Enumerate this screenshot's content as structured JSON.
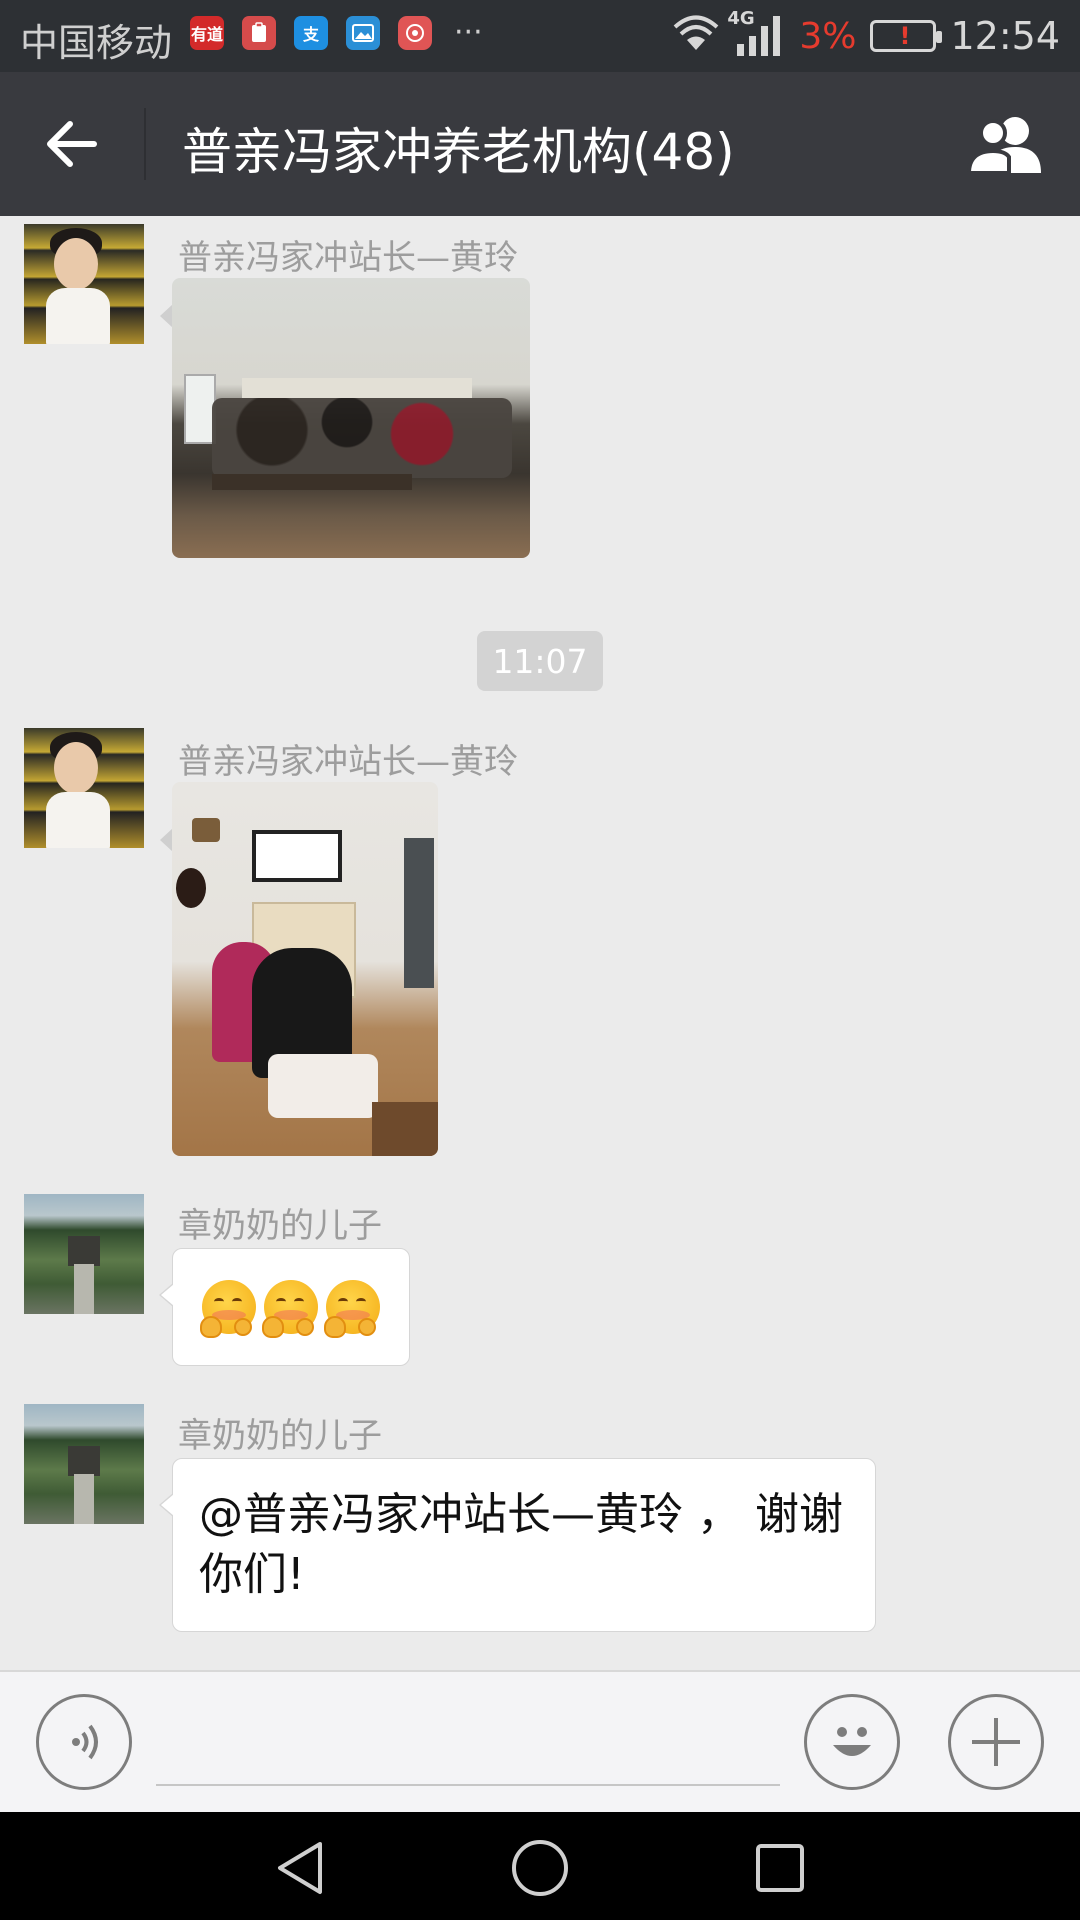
{
  "status_bar": {
    "carrier": "中国移动",
    "app_icons": [
      "youdao-icon",
      "clipboard-icon",
      "alipay-icon",
      "gallery-icon",
      "recorder-icon"
    ],
    "youdao_label": "有道",
    "alipay_label": "支",
    "more": "···",
    "network": "4G",
    "battery_percent": "3%",
    "time": "12:54",
    "battery_color": "#e63b2e"
  },
  "header": {
    "title": "普亲冯家冲养老机构(48)",
    "background": "#393a3f"
  },
  "messages": [
    {
      "type": "image",
      "sender": "普亲冯家冲站长—黄玲",
      "avatar": "girl-avatar",
      "image": "group-photo"
    },
    {
      "type": "timestamp",
      "text": "11:07"
    },
    {
      "type": "image",
      "sender": "普亲冯家冲站长—黄玲",
      "avatar": "girl-avatar",
      "image": "room-photo"
    },
    {
      "type": "emoji",
      "sender": "章奶奶的儿子",
      "avatar": "garden-avatar",
      "emojis": [
        "blush-hug-emoji",
        "blush-hug-emoji",
        "blush-hug-emoji"
      ]
    },
    {
      "type": "text",
      "sender": "章奶奶的儿子",
      "avatar": "garden-avatar",
      "text": "@普亲冯家冲站长—黄玲 ， 谢谢你们!"
    }
  ],
  "input_bar": {
    "text_value": "",
    "voice_icon": "voice-icon",
    "emoji_icon": "emoji-icon",
    "plus_icon": "plus-icon"
  },
  "nav_bar": {
    "buttons": [
      "back-triangle-icon",
      "home-circle-icon",
      "recent-square-icon"
    ]
  }
}
